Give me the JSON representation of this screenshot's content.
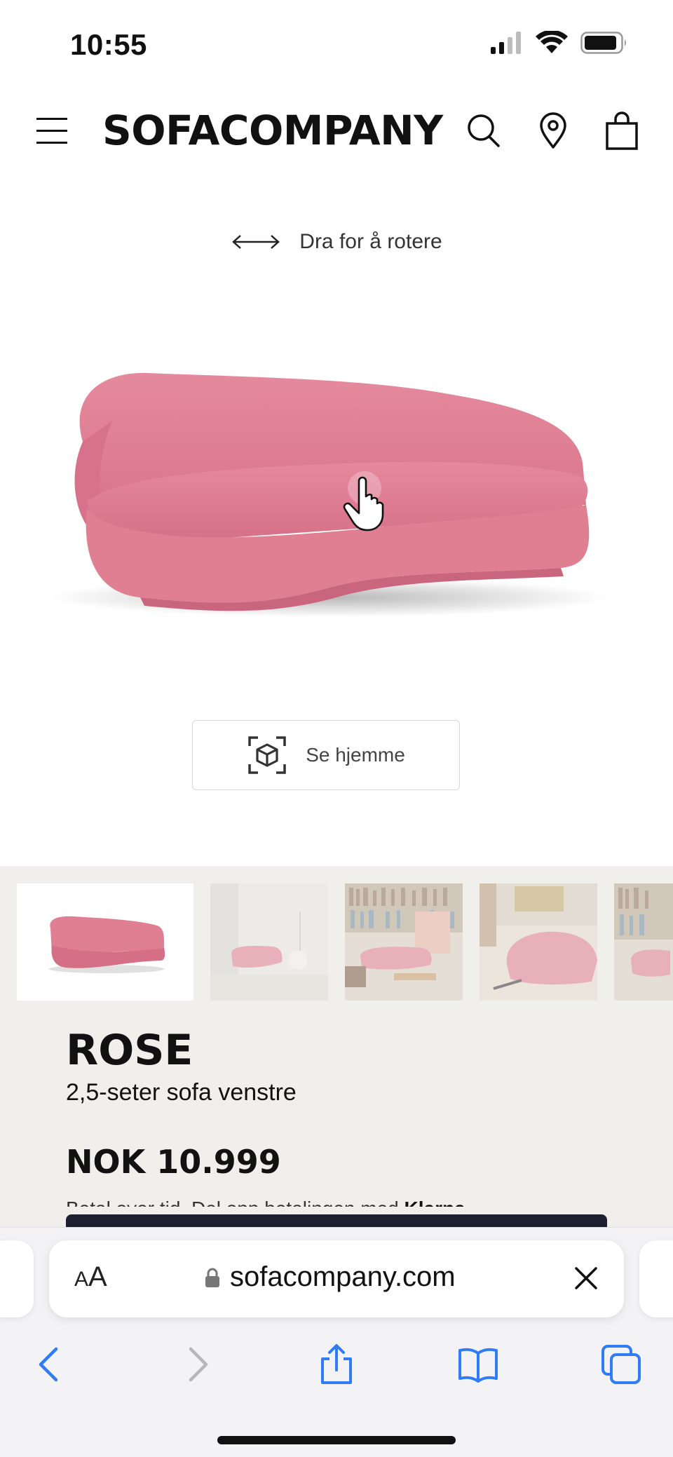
{
  "status_bar": {
    "time": "10:55",
    "icons": [
      "cellular-signal-icon",
      "wifi-icon",
      "battery-icon"
    ]
  },
  "header": {
    "logo": "SOFACOMPANY",
    "icons": [
      "hamburger-menu-icon",
      "search-icon",
      "location-pin-icon",
      "shopping-bag-icon"
    ]
  },
  "viewer": {
    "rotate_hint": "Dra for å rotere",
    "rotate_icon": "double-arrow-icon",
    "drag_icon": "hand-pointer-icon",
    "ar_button_label": "Se hjemme",
    "ar_icon": "ar-cube-icon",
    "sofa_color": "#e07e92"
  },
  "gallery": {
    "thumbnails": [
      "thumbnail-1",
      "thumbnail-2",
      "thumbnail-3",
      "thumbnail-4",
      "thumbnail-5"
    ],
    "selected_index": 0
  },
  "product": {
    "name": "ROSE",
    "subtitle": "2,5-seter sofa venstre",
    "price": "NOK 10.999",
    "payment_text": "Betal over tid. Del opp betalingen med",
    "payment_brand": "Klarna"
  },
  "browser": {
    "aa_large": "A",
    "aa_small": "A",
    "url": "sofacompany.com",
    "accent_color": "#2f7cf6",
    "nav_icons": [
      "back-icon",
      "forward-icon",
      "share-icon",
      "bookmarks-icon",
      "tabs-icon"
    ]
  },
  "colors": {
    "product_bg": "#f1efeb",
    "text": "#111111"
  }
}
